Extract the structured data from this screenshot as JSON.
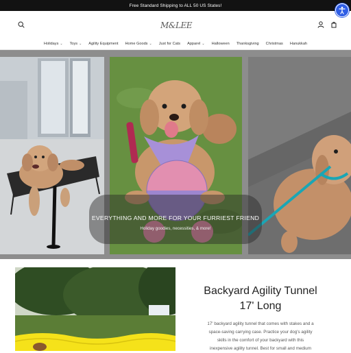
{
  "announcement": {
    "text": "Free Standard Shipping to ALL 50 US States!"
  },
  "accessibility": {
    "icon": "accessibility-icon",
    "color": "#2f5ee5"
  },
  "header": {
    "logo_text": "M&LEE",
    "icons": [
      "search-icon",
      "account-icon",
      "cart-icon"
    ]
  },
  "nav": {
    "items": [
      {
        "label": "Holidays",
        "has_dropdown": true
      },
      {
        "label": "Toys",
        "has_dropdown": true
      },
      {
        "label": "Agility Equipment",
        "has_dropdown": false
      },
      {
        "label": "Home Goods",
        "has_dropdown": true
      },
      {
        "label": "Just for Cats",
        "has_dropdown": false
      },
      {
        "label": "Apparel",
        "has_dropdown": true
      },
      {
        "label": "Halloween",
        "has_dropdown": false
      },
      {
        "label": "Thanksgiving",
        "has_dropdown": false
      },
      {
        "label": "Christmas",
        "has_dropdown": false
      },
      {
        "label": "Hanukkah",
        "has_dropdown": false
      }
    ]
  },
  "hero": {
    "title": "EVERYTHING AND MORE FOR YOUR FURRIEST FRIEND",
    "subtitle": "Holiday goodies, necessities, & more!"
  },
  "feature": {
    "title_line1": "Backyard Agility Tunnel",
    "title_line2": "17' Long",
    "desc_line1": "17' backyard agility tunnel that comes with stakes and a",
    "desc_line2": "space-saving carrying case. Practice your dog's agility",
    "desc_line3": "skills in the comfort of your backyard with this",
    "desc_line4": "inexpensive agility tunnel. Best for small and medium"
  },
  "colors": {
    "announcement_bg": "#121212",
    "tunnel_yellow": "#f5e21a",
    "bandana_lilac": "#a790d8"
  }
}
